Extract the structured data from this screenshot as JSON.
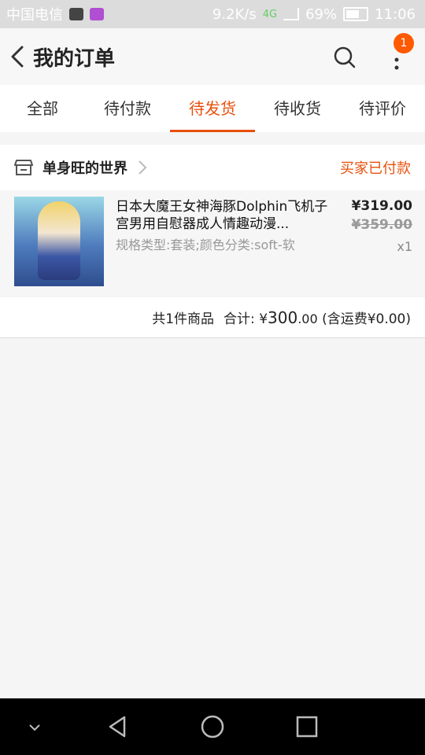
{
  "status_bar": {
    "carrier": "中国电信",
    "speed": "9.2K/s",
    "network": "4G",
    "battery": "69%",
    "time": "11:06"
  },
  "header": {
    "title": "我的订单",
    "notification_count": "1"
  },
  "tabs": [
    {
      "label": "全部",
      "active": false
    },
    {
      "label": "待付款",
      "active": false
    },
    {
      "label": "待发货",
      "active": true
    },
    {
      "label": "待收货",
      "active": false
    },
    {
      "label": "待评价",
      "active": false
    }
  ],
  "order": {
    "shop_name": "单身旺的世界",
    "status": "买家已付款",
    "item": {
      "title": "日本大魔王女神海豚Dolphin飞机子宫男用自慰器成人情趣动漫...",
      "spec": "规格类型:套装;颜色分类:soft-软",
      "price": "¥319.00",
      "original_price": "¥359.00",
      "quantity": "x1"
    },
    "summary": {
      "count_text": "共1件商品",
      "total_label": "合计:",
      "total_currency": "¥",
      "total_int": "300",
      "total_dec": ".00",
      "shipping": "(含运费¥0.00)"
    }
  },
  "colors": {
    "accent": "#e8500c",
    "badge": "#ff5a00"
  }
}
